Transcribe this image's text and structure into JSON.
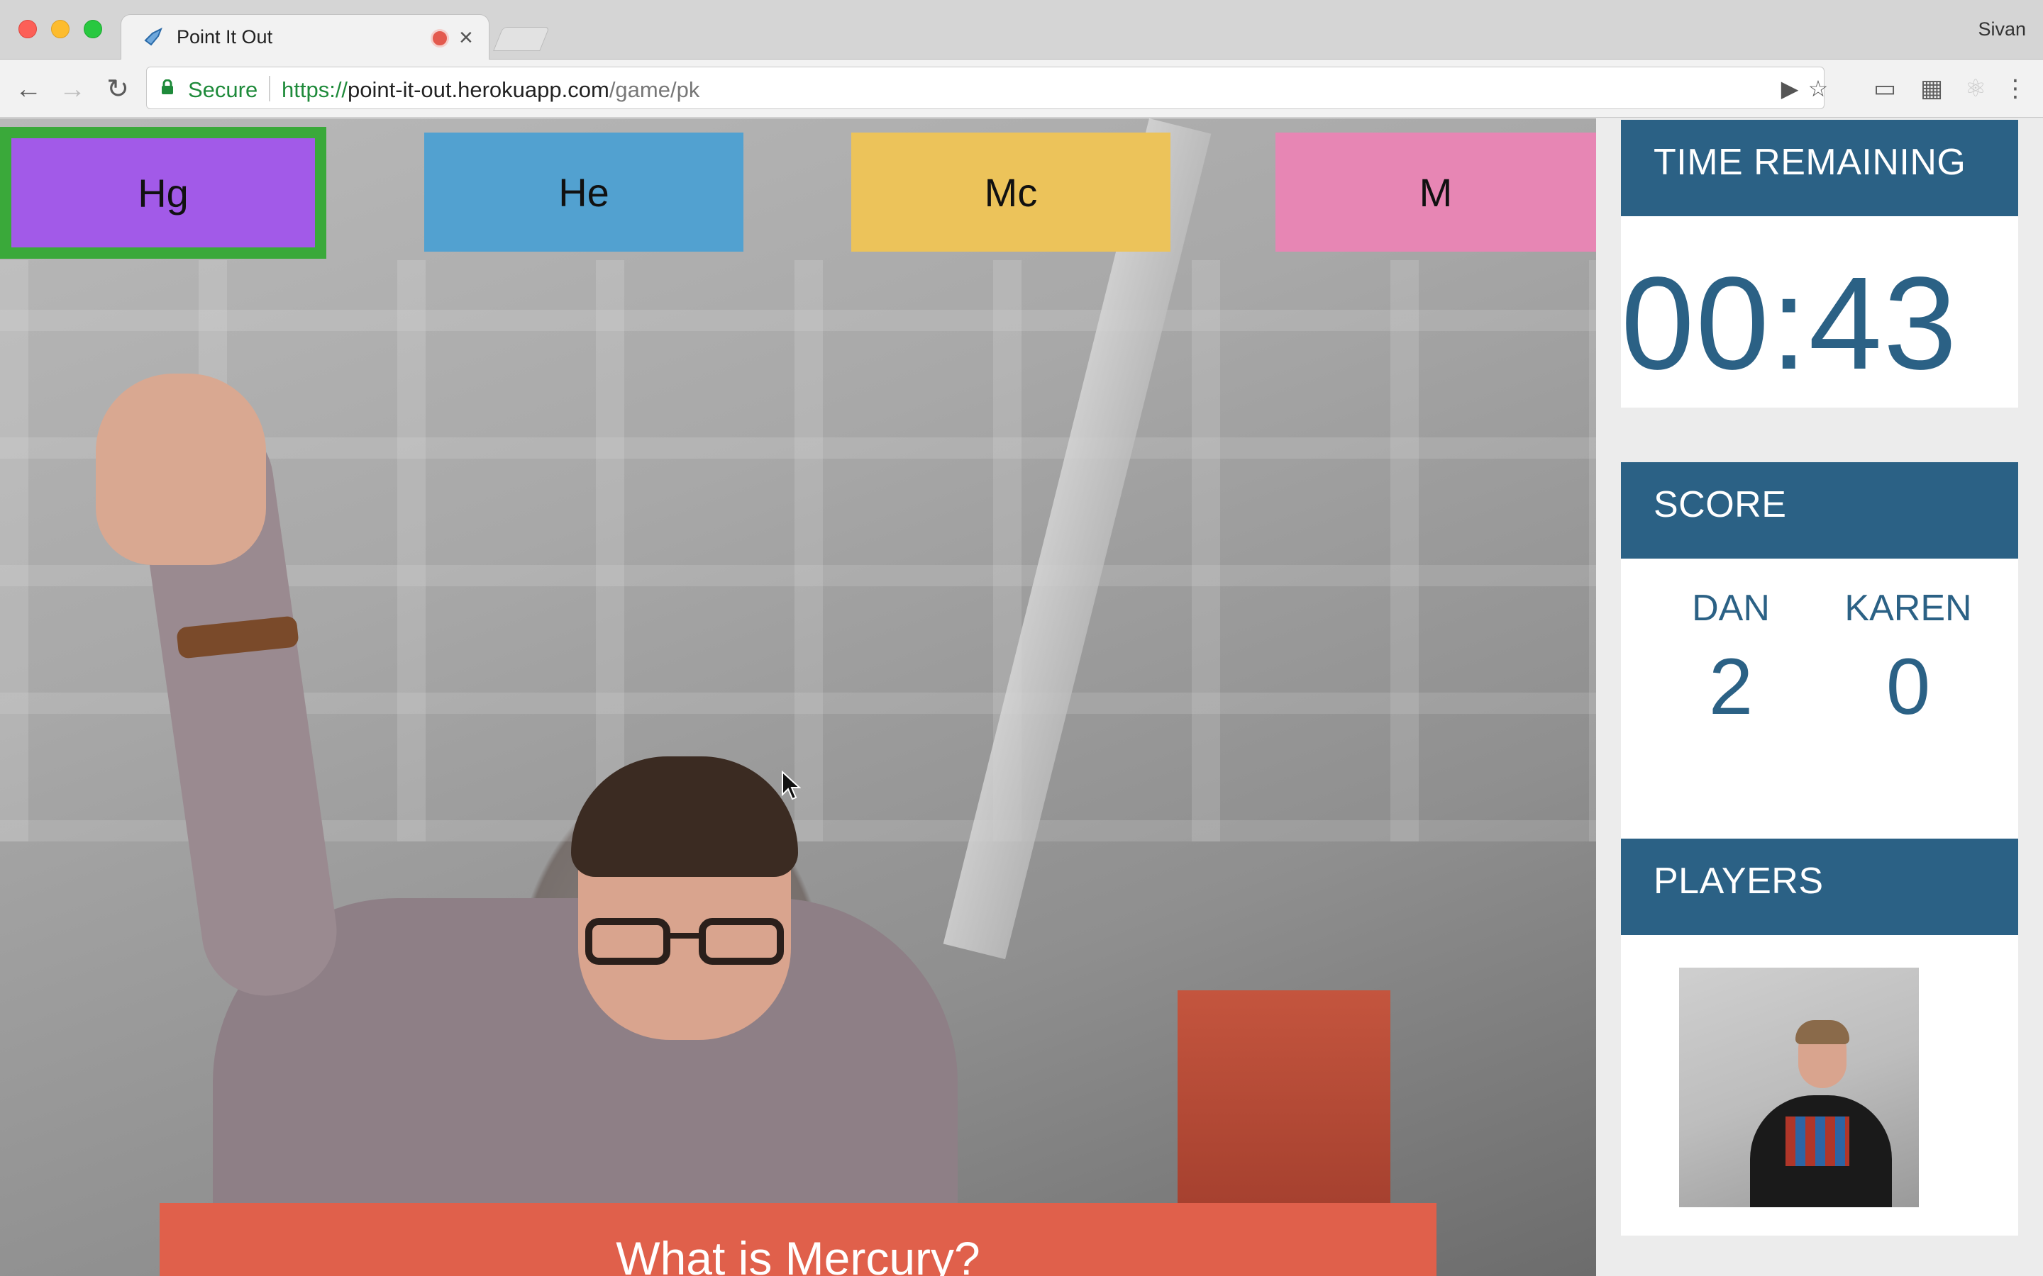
{
  "browser": {
    "tab_title": "Point It Out",
    "profile_name": "Sivan",
    "secure_label": "Secure",
    "url_scheme": "https://",
    "url_host": "point-it-out.herokuapp.com",
    "url_path": "/game/pk",
    "icons": {
      "back": "arrow-left-icon",
      "forward": "arrow-right-icon",
      "reload": "reload-icon",
      "camera": "video-camera-icon",
      "bookmark": "star-icon",
      "cast": "cast-icon",
      "extension_qr": "qr-extension-icon",
      "extension_react": "react-extension-icon",
      "menu": "kebab-menu-icon"
    }
  },
  "game": {
    "answers": [
      {
        "label": "Hg",
        "color": "#a25ae8",
        "selected": true,
        "highlight_color": "#3aa93a"
      },
      {
        "label": "He",
        "color": "#52a1d0",
        "selected": false
      },
      {
        "label": "Mc",
        "color": "#ecc35a",
        "selected": false
      },
      {
        "label": "M",
        "color": "#e786b4",
        "selected": false
      }
    ],
    "question": "What is Mercury?",
    "question_color": "#e0604b"
  },
  "sidebar": {
    "accent_color": "#2b6185",
    "time": {
      "heading": "TIME REMAINING",
      "value": "00:43"
    },
    "score": {
      "heading": "SCORE",
      "players": [
        {
          "name": "DAN",
          "score": "2"
        },
        {
          "name": "KAREN",
          "score": "0"
        }
      ]
    },
    "players": {
      "heading": "PLAYERS"
    }
  }
}
